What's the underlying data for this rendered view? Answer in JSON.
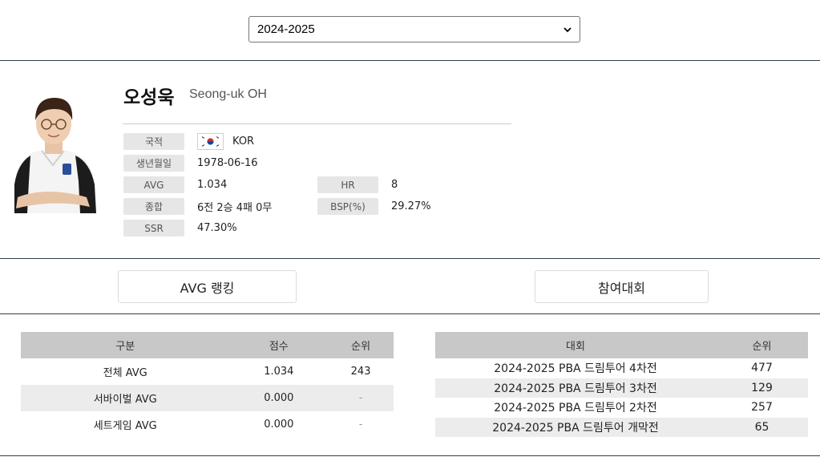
{
  "season": {
    "selected": "2024-2025"
  },
  "player": {
    "name_ko": "오성욱",
    "name_en": "Seong-uk OH",
    "labels": {
      "nationality": "국적",
      "birth": "생년월일",
      "avg": "AVG",
      "record": "종합",
      "ssr": "SSR",
      "hr": "HR",
      "bsp": "BSP(%)"
    },
    "values": {
      "nationality": "KOR",
      "birth": "1978-06-16",
      "avg": "1.034",
      "record": "6전 2승 4패 0무",
      "ssr": "47.30%",
      "hr": "8",
      "bsp": "29.27%"
    }
  },
  "tabs": {
    "avg_ranking": "AVG 랭킹",
    "tournaments": "참여대회"
  },
  "avg_table": {
    "headers": [
      "구분",
      "점수",
      "순위"
    ],
    "rows": [
      [
        "전체 AVG",
        "1.034",
        "243"
      ],
      [
        "서바이벌 AVG",
        "0.000",
        "-"
      ],
      [
        "세트게임 AVG",
        "0.000",
        "-"
      ]
    ]
  },
  "tour_table": {
    "headers": [
      "대회",
      "순위"
    ],
    "rows": [
      [
        "2024-2025 PBA 드림투어 4차전",
        "477"
      ],
      [
        "2024-2025 PBA 드림투어 3차전",
        "129"
      ],
      [
        "2024-2025 PBA 드림투어 2차전",
        "257"
      ],
      [
        "2024-2025 PBA 드림투어 개막전",
        "65"
      ]
    ]
  },
  "colors": {
    "divider": "#2f3e4c",
    "header_bg": "#c8c8c8",
    "label_bg": "#e6e6e6",
    "row_alt": "#ececec"
  },
  "icons": {
    "select": "chevron-down-icon",
    "flag": "korea-flag-icon",
    "photo": "player-photo"
  }
}
